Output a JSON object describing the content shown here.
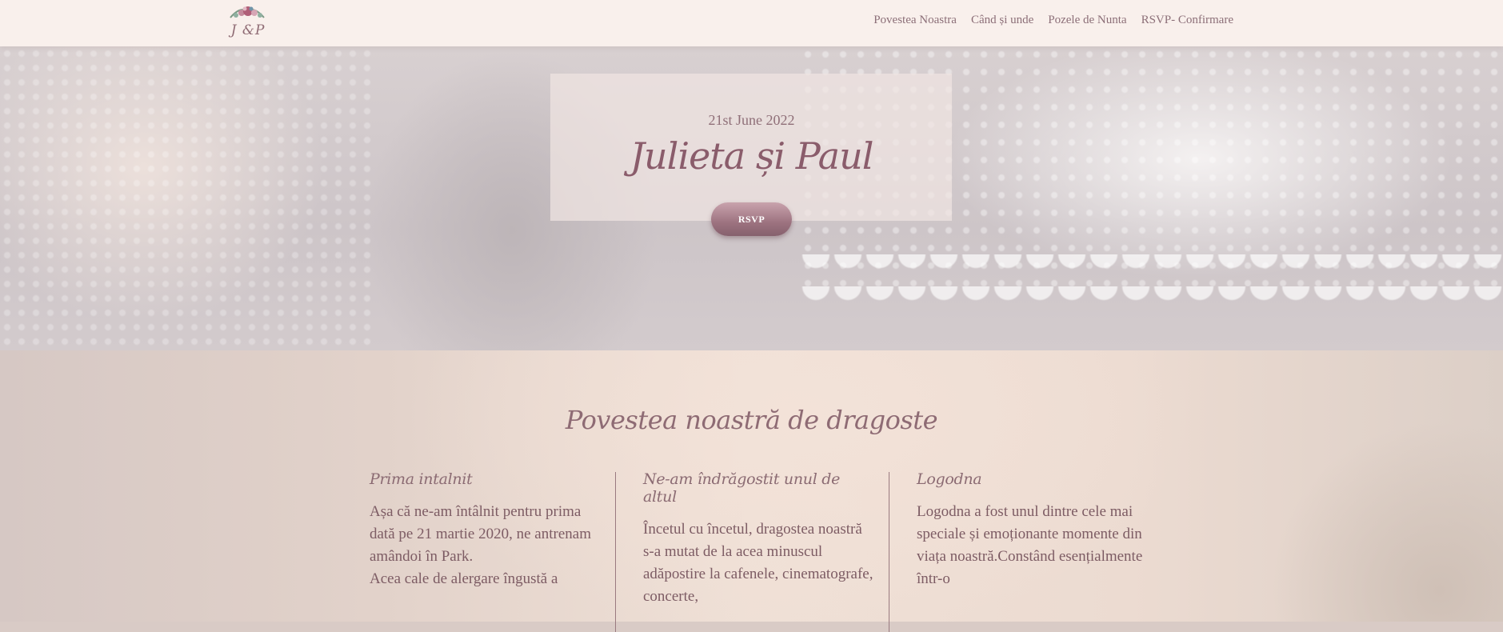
{
  "header": {
    "logo_text": "J &P",
    "nav": [
      {
        "label": "Povestea Noastra"
      },
      {
        "label": "Când și unde"
      },
      {
        "label": "Pozele de Nunta"
      },
      {
        "label": "RSVP- Confirmare"
      }
    ]
  },
  "hero": {
    "date": "21st June 2022",
    "names": "Julieta și Paul",
    "rsvp_label": "RSVP"
  },
  "story": {
    "title": "Povestea noastră de dragoste",
    "columns": [
      {
        "heading": "Prima intalnit",
        "text": "Așa că ne-am întâlnit pentru prima dată pe 21 martie 2020, ne antrenam amândoi în Park.\nAcea cale de alergare îngustă a"
      },
      {
        "heading": "Ne-am îndrăgostit unul de altul",
        "text": "Încetul cu încetul, dragostea noastră s-a mutat de la acea minuscul adăpostire la cafenele, cinematografe, concerte,"
      },
      {
        "heading": "Logodna",
        "text": "Logodna a fost unul dintre cele mai speciale și emoționante momente din viața noastră.Constând esențialmente într-o"
      }
    ]
  },
  "colors": {
    "header_bg": "#f9f0ec",
    "accent": "#8a5c6b",
    "button": "#9d7380"
  }
}
